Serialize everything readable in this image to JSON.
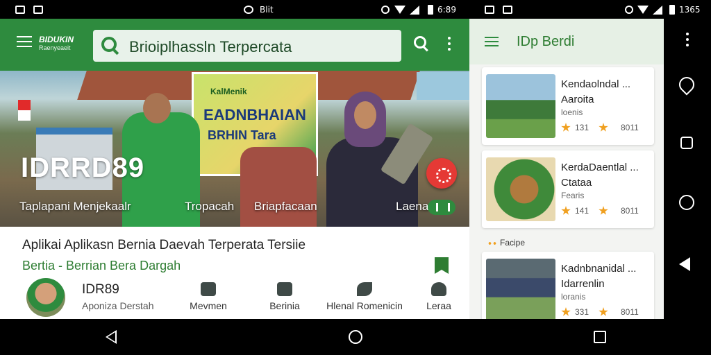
{
  "status_left": {
    "app_label": "Blit",
    "time": "6:89"
  },
  "status_right": {
    "time": "1365"
  },
  "left_app": {
    "logo_top": "BIDUKIN",
    "logo_bottom": "Raenyeaeit",
    "search_text": "Brioiplhassln Terpercata",
    "hero": {
      "banner_line1": "KalMenik",
      "banner_line2": "EADNBHAIAN",
      "banner_line3": "BRHIN Tara",
      "title": "IDRRD89",
      "tabs": [
        "Taplapani Menjekaalr",
        "Tropacah",
        "Briapfacaan",
        "Laena"
      ]
    },
    "info": {
      "title": "Aplikai Aplikasn Bernia Daevah Terperata Tersiie",
      "subtitle": "Bertia - Berrian Bera Dargah",
      "profile_name": "IDR89",
      "profile_sub": "Aponiza Derstah",
      "nav": [
        {
          "label": "Mevmen",
          "icon": "scissors-icon"
        },
        {
          "label": "Berinia",
          "icon": "square-icon"
        },
        {
          "label": "Hlenal Romenicin",
          "icon": "leaf-icon"
        },
        {
          "label": "Leraa",
          "icon": "person-icon"
        }
      ]
    }
  },
  "right_app": {
    "title": "IDp Berdi",
    "section_label": "Facipe",
    "cards": [
      {
        "line1": "Kendaolndal ...",
        "line2": "Aaroita",
        "meta": "loenis",
        "n1": "131",
        "n2": "8011"
      },
      {
        "line1": "KerdaDaentlal ...",
        "line2": "Ctataa",
        "meta": "Fearis",
        "n1": "141",
        "n2": "8011"
      },
      {
        "line1": "Kadnbnanidal ...",
        "line2": "Idarrenlin",
        "meta": "loranis",
        "n1": "331",
        "n2": "8011"
      }
    ]
  },
  "colors": {
    "brand_green": "#2e8b3e",
    "accent_red": "#e53935",
    "star": "#f0a020"
  }
}
